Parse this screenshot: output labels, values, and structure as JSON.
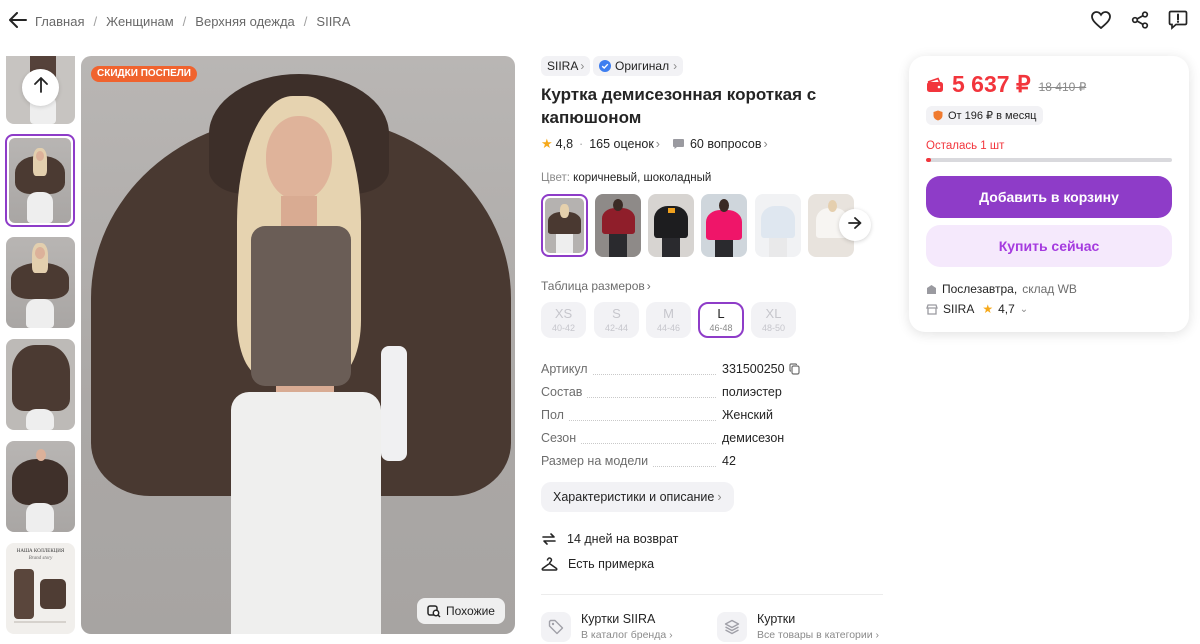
{
  "breadcrumb": [
    "Главная",
    "Женщинам",
    "Верхняя одежда",
    "SIIRA"
  ],
  "header_icons": [
    "heart-icon",
    "share-icon",
    "report-icon"
  ],
  "gallery": {
    "badge": "СКИДКИ ПОСПЕЛИ",
    "similar_button": "Похожие",
    "thumb_collection_title": "НАША КОЛЛЕКЦИЯ",
    "thumb_collection_subtitle": "Brand story"
  },
  "product": {
    "brand": "SIIRA",
    "original_label": "Оригинал",
    "title": "Куртка демисезонная короткая с капюшоном",
    "rating": "4,8",
    "reviews": "165 оценок",
    "questions": "60 вопросов",
    "color_label": "Цвет:",
    "color_value": "коричневый, шоколадный",
    "size_table_label": "Таблица размеров",
    "sizes": [
      {
        "name": "XS",
        "range": "40-42",
        "selected": false
      },
      {
        "name": "S",
        "range": "42-44",
        "selected": false
      },
      {
        "name": "M",
        "range": "44-46",
        "selected": false
      },
      {
        "name": "L",
        "range": "46-48",
        "selected": true
      },
      {
        "name": "XL",
        "range": "48-50",
        "selected": false
      }
    ],
    "specs": [
      {
        "key": "Артикул",
        "value": "331500250"
      },
      {
        "key": "Состав",
        "value": "полиэстер"
      },
      {
        "key": "Пол",
        "value": "Женский"
      },
      {
        "key": "Сезон",
        "value": "демисезон"
      },
      {
        "key": "Размер на модели",
        "value": "42"
      }
    ],
    "details_button": "Характеристики и описание",
    "returns": "14 дней на возврат",
    "fitting": "Есть примерка",
    "links": [
      {
        "title": "Куртки SIIRA",
        "subtitle": "В каталог бренда"
      },
      {
        "title": "Куртки",
        "subtitle": "Все товары в категории"
      }
    ]
  },
  "buy": {
    "price": "5 637 ₽",
    "old_price": "18 410 ₽",
    "installment": "От 196 ₽ в месяц",
    "stock": "Осталась 1 шт",
    "stock_fraction": 0.02,
    "add_to_cart": "Добавить в корзину",
    "buy_now": "Купить сейчас",
    "delivery_day": "Послезавтра,",
    "delivery_place": "склад WB",
    "seller": "SIIRA",
    "seller_rating": "4,7"
  },
  "colors": {
    "accent": "#8e3cc8",
    "price": "#f2353c",
    "buy_now_bg": "#f5e9fc",
    "buy_now_text": "#a53bdf",
    "badge": "#f0632e"
  }
}
